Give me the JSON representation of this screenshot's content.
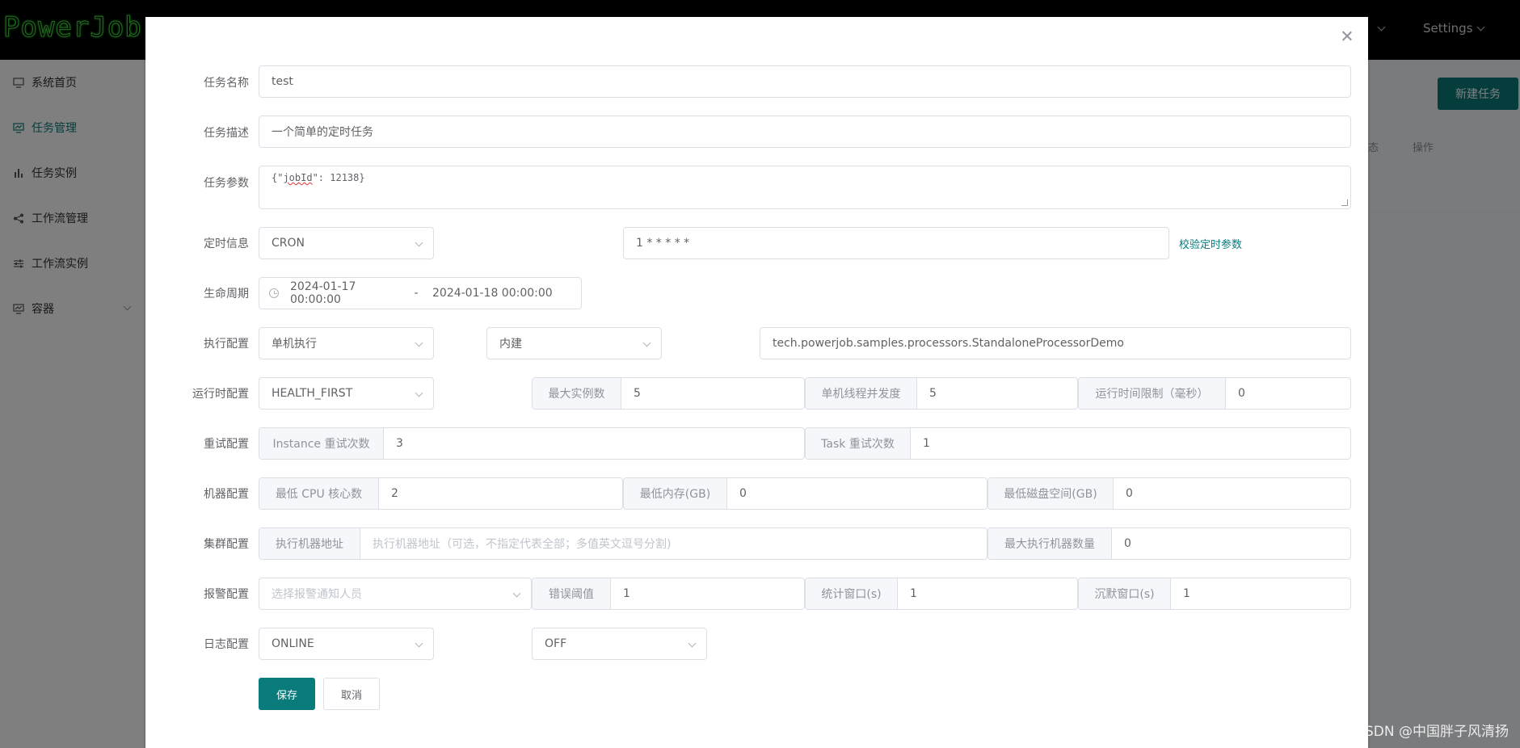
{
  "app": {
    "logo_text": "PowerJob",
    "top_menu": {
      "settings": "Settings"
    }
  },
  "sidebar": {
    "items": [
      {
        "label": "系统首页",
        "icon": "monitor-icon"
      },
      {
        "label": "任务管理",
        "icon": "task-board-icon",
        "active": true
      },
      {
        "label": "任务实例",
        "icon": "bar-chart-icon"
      },
      {
        "label": "工作流管理",
        "icon": "share-icon"
      },
      {
        "label": "工作流实例",
        "icon": "sliders-icon"
      },
      {
        "label": "容器",
        "icon": "container-icon"
      }
    ]
  },
  "main": {
    "new_task_button": "新建任务",
    "table_col_op": "操作",
    "table_col_partial": "态"
  },
  "dialog": {
    "task_name": {
      "label": "任务名称",
      "value": "test"
    },
    "task_desc": {
      "label": "任务描述",
      "value": "一个简单的定时任务"
    },
    "task_params": {
      "label": "任务参数",
      "value_prefix": "{\"",
      "value_word": "jobId",
      "value_suffix": "\": 12138}"
    },
    "schedule": {
      "label": "定时信息",
      "type": "CRON",
      "expression": "1 * * * * *",
      "validate_link": "校验定时参数"
    },
    "lifecycle": {
      "label": "生命周期",
      "start": "2024-01-17 00:00:00",
      "separator": "-",
      "end": "2024-01-18 00:00:00"
    },
    "exec_config": {
      "label": "执行配置",
      "mode": "单机执行",
      "processor_type": "内建",
      "processor": "tech.powerjob.samples.processors.StandaloneProcessorDemo"
    },
    "runtime_config": {
      "label": "运行时配置",
      "dispatch": "HEALTH_FIRST",
      "max_instances_label": "最大实例数",
      "max_instances": "5",
      "concurrency_label": "单机线程并发度",
      "concurrency": "5",
      "time_limit_label": "运行时间限制（毫秒）",
      "time_limit": "0"
    },
    "retry_config": {
      "label": "重试配置",
      "instance_retry_label": "Instance 重试次数",
      "instance_retry": "3",
      "task_retry_label": "Task 重试次数",
      "task_retry": "1"
    },
    "machine_config": {
      "label": "机器配置",
      "min_cpu_label": "最低 CPU 核心数",
      "min_cpu": "2",
      "min_mem_label": "最低内存(GB)",
      "min_mem": "0",
      "min_disk_label": "最低磁盘空间(GB)",
      "min_disk": "0"
    },
    "cluster_config": {
      "label": "集群配置",
      "address_label": "执行机器地址",
      "address_placeholder": "执行机器地址（可选，不指定代表全部；多值英文逗号分割)",
      "max_workers_label": "最大执行机器数量",
      "max_workers": "0"
    },
    "alarm_config": {
      "label": "报警配置",
      "receivers_placeholder": "选择报警通知人员",
      "threshold_label": "错误阈值",
      "threshold": "1",
      "stat_window_label": "统计窗口(s)",
      "stat_window": "1",
      "silence_window_label": "沉默窗口(s)",
      "silence_window": "1"
    },
    "log_config": {
      "label": "日志配置",
      "type": "ONLINE",
      "level": "OFF"
    },
    "buttons": {
      "save": "保存",
      "cancel": "取消"
    }
  },
  "watermark": "CSDN @中国胖子风清扬",
  "colors": {
    "primary": "#0a7b7b",
    "overlay": "rgba(0,0,0,0.5)"
  }
}
